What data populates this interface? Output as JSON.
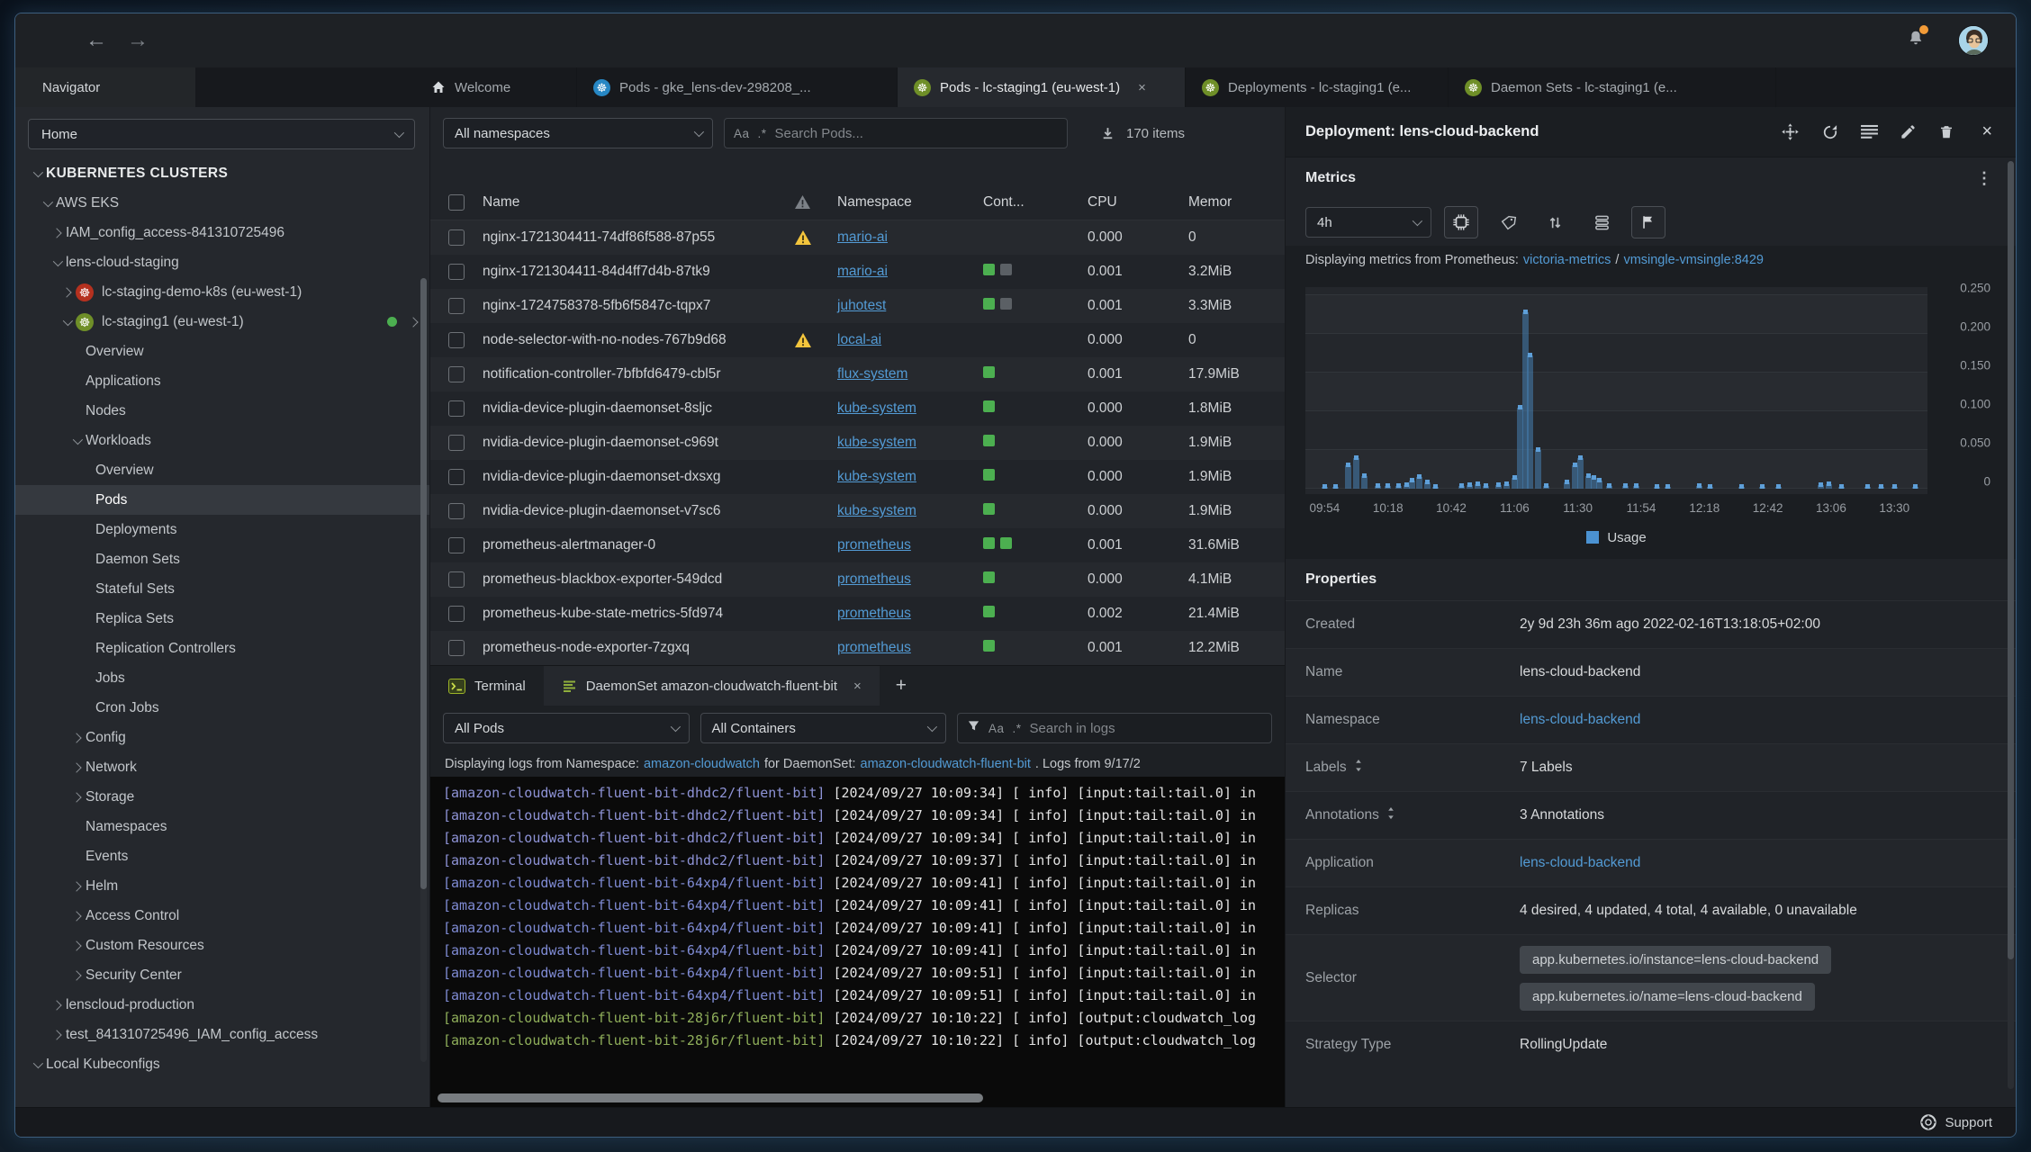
{
  "toolbar": {
    "back": "←",
    "forward": "→",
    "icons": [
      "notifications-bell",
      "user-avatar"
    ]
  },
  "tabs": {
    "navigator_label": "Navigator",
    "items": [
      {
        "label": "Welcome",
        "icon": "home"
      },
      {
        "label": "Pods - gke_lens-dev-298208_...",
        "icon": "k8s-blue"
      },
      {
        "label": "Pods - lc-staging1 (eu-west-1)",
        "icon": "k8s-green",
        "active": true,
        "closable": true
      },
      {
        "label": "Deployments - lc-staging1 (e...",
        "icon": "k8s-green"
      },
      {
        "label": "Daemon Sets - lc-staging1 (e...",
        "icon": "k8s-green"
      }
    ]
  },
  "sidebar": {
    "context_select": "Home",
    "tree": [
      {
        "depth": 0,
        "chevron": "down",
        "label": "KUBERNETES CLUSTERS",
        "section": true
      },
      {
        "depth": 1,
        "chevron": "down",
        "label": "AWS EKS"
      },
      {
        "depth": 2,
        "chevron": "right",
        "label": "IAM_config_access-841310725496"
      },
      {
        "depth": 2,
        "chevron": "down",
        "label": "lens-cloud-staging"
      },
      {
        "depth": 3,
        "chevron": "right",
        "icon": "k8s-red",
        "label": "lc-staging-demo-k8s (eu-west-1)"
      },
      {
        "depth": 3,
        "chevron": "down",
        "icon": "k8s-green",
        "label": "lc-staging1 (eu-west-1)",
        "trailing": true
      },
      {
        "depth": 4,
        "label": "Overview"
      },
      {
        "depth": 4,
        "label": "Applications"
      },
      {
        "depth": 4,
        "label": "Nodes"
      },
      {
        "depth": 4,
        "chevron": "down",
        "label": "Workloads"
      },
      {
        "depth": 5,
        "label": "Overview"
      },
      {
        "depth": 5,
        "label": "Pods",
        "selected": true
      },
      {
        "depth": 5,
        "label": "Deployments"
      },
      {
        "depth": 5,
        "label": "Daemon Sets"
      },
      {
        "depth": 5,
        "label": "Stateful Sets"
      },
      {
        "depth": 5,
        "label": "Replica Sets"
      },
      {
        "depth": 5,
        "label": "Replication Controllers"
      },
      {
        "depth": 5,
        "label": "Jobs"
      },
      {
        "depth": 5,
        "label": "Cron Jobs"
      },
      {
        "depth": 4,
        "chevron": "right",
        "label": "Config"
      },
      {
        "depth": 4,
        "chevron": "right",
        "label": "Network"
      },
      {
        "depth": 4,
        "chevron": "right",
        "label": "Storage"
      },
      {
        "depth": 4,
        "label": "Namespaces"
      },
      {
        "depth": 4,
        "label": "Events"
      },
      {
        "depth": 4,
        "chevron": "right",
        "label": "Helm"
      },
      {
        "depth": 4,
        "chevron": "right",
        "label": "Access Control"
      },
      {
        "depth": 4,
        "chevron": "right",
        "label": "Custom Resources"
      },
      {
        "depth": 4,
        "chevron": "right",
        "label": "Security Center"
      },
      {
        "depth": 2,
        "chevron": "right",
        "label": "lenscloud-production"
      },
      {
        "depth": 2,
        "chevron": "right",
        "label": "test_841310725496_IAM_config_access"
      },
      {
        "depth": 0,
        "chevron": "down",
        "label": "Local Kubeconfigs"
      }
    ]
  },
  "pods_view": {
    "namespace_filter": "All namespaces",
    "search_placeholder": "Search Pods...",
    "case_icon": "Aa",
    "regex_icon": ".*",
    "items_count": "170 items",
    "columns": {
      "name": "Name",
      "namespace": "Namespace",
      "containers": "Cont...",
      "cpu": "CPU",
      "memory": "Memor"
    },
    "rows": [
      {
        "name": "nginx-1721304411-74df86f588-87p55",
        "warning": true,
        "namespace": "mario-ai",
        "containers": [],
        "cpu": "0.000",
        "memory": "0"
      },
      {
        "name": "nginx-1721304411-84d4ff7d4b-87tk9",
        "warning": false,
        "namespace": "mario-ai",
        "containers": [
          "ok",
          "off"
        ],
        "cpu": "0.001",
        "memory": "3.2MiB"
      },
      {
        "name": "nginx-1724758378-5fb6f5847c-tqpx7",
        "warning": false,
        "namespace": "juhotest",
        "containers": [
          "ok",
          "off"
        ],
        "cpu": "0.001",
        "memory": "3.3MiB"
      },
      {
        "name": "node-selector-with-no-nodes-767b9d68",
        "warning": true,
        "namespace": "local-ai",
        "containers": [],
        "cpu": "0.000",
        "memory": "0"
      },
      {
        "name": "notification-controller-7bfbfd6479-cbl5r",
        "warning": false,
        "namespace": "flux-system",
        "containers": [
          "ok"
        ],
        "cpu": "0.001",
        "memory": "17.9MiB"
      },
      {
        "name": "nvidia-device-plugin-daemonset-8sljc",
        "warning": false,
        "namespace": "kube-system",
        "containers": [
          "ok"
        ],
        "cpu": "0.000",
        "memory": "1.8MiB"
      },
      {
        "name": "nvidia-device-plugin-daemonset-c969t",
        "warning": false,
        "namespace": "kube-system",
        "containers": [
          "ok"
        ],
        "cpu": "0.000",
        "memory": "1.9MiB"
      },
      {
        "name": "nvidia-device-plugin-daemonset-dxsxg",
        "warning": false,
        "namespace": "kube-system",
        "containers": [
          "ok"
        ],
        "cpu": "0.000",
        "memory": "1.9MiB"
      },
      {
        "name": "nvidia-device-plugin-daemonset-v7sc6",
        "warning": false,
        "namespace": "kube-system",
        "containers": [
          "ok"
        ],
        "cpu": "0.000",
        "memory": "1.9MiB"
      },
      {
        "name": "prometheus-alertmanager-0",
        "warning": false,
        "namespace": "prometheus",
        "containers": [
          "ok",
          "ok"
        ],
        "cpu": "0.001",
        "memory": "31.6MiB"
      },
      {
        "name": "prometheus-blackbox-exporter-549dcd",
        "warning": false,
        "namespace": "prometheus",
        "containers": [
          "ok"
        ],
        "cpu": "0.000",
        "memory": "4.1MiB"
      },
      {
        "name": "prometheus-kube-state-metrics-5fd974",
        "warning": false,
        "namespace": "prometheus",
        "containers": [
          "ok"
        ],
        "cpu": "0.002",
        "memory": "21.4MiB"
      },
      {
        "name": "prometheus-node-exporter-7zgxq",
        "warning": false,
        "namespace": "prometheus",
        "containers": [
          "ok"
        ],
        "cpu": "0.001",
        "memory": "12.2MiB"
      }
    ]
  },
  "dock": {
    "tabs": [
      {
        "label": "Terminal",
        "icon": "terminal"
      },
      {
        "label": "DaemonSet amazon-cloudwatch-fluent-bit",
        "icon": "logs",
        "active": true,
        "closable": true
      }
    ],
    "new_tab": "+",
    "pod_filter": "All Pods",
    "container_filter": "All Containers",
    "search_placeholder": "Search in logs",
    "log_info": {
      "prefix": "Displaying logs from Namespace:",
      "namespace_link": "amazon-cloudwatch",
      "mid": "for DaemonSet:",
      "daemonset_link": "amazon-cloudwatch-fluent-bit",
      "suffix": ". Logs from 9/17/2"
    },
    "log_lines": [
      {
        "prefix": "[amazon-cloudwatch-fluent-bit-dhdc2/fluent-bit]",
        "color": "purple",
        "body": "[2024/09/27 10:09:34] [ info] [input:tail:tail.0] in"
      },
      {
        "prefix": "[amazon-cloudwatch-fluent-bit-dhdc2/fluent-bit]",
        "color": "purple",
        "body": "[2024/09/27 10:09:34] [ info] [input:tail:tail.0] in"
      },
      {
        "prefix": "[amazon-cloudwatch-fluent-bit-dhdc2/fluent-bit]",
        "color": "purple",
        "body": "[2024/09/27 10:09:34] [ info] [input:tail:tail.0] in"
      },
      {
        "prefix": "[amazon-cloudwatch-fluent-bit-dhdc2/fluent-bit]",
        "color": "purple",
        "body": "[2024/09/27 10:09:37] [ info] [input:tail:tail.0] in"
      },
      {
        "prefix": "[amazon-cloudwatch-fluent-bit-64xp4/fluent-bit]",
        "color": "blue",
        "body": "[2024/09/27 10:09:41] [ info] [input:tail:tail.0] in"
      },
      {
        "prefix": "[amazon-cloudwatch-fluent-bit-64xp4/fluent-bit]",
        "color": "blue",
        "body": "[2024/09/27 10:09:41] [ info] [input:tail:tail.0] in"
      },
      {
        "prefix": "[amazon-cloudwatch-fluent-bit-64xp4/fluent-bit]",
        "color": "blue",
        "body": "[2024/09/27 10:09:41] [ info] [input:tail:tail.0] in"
      },
      {
        "prefix": "[amazon-cloudwatch-fluent-bit-64xp4/fluent-bit]",
        "color": "blue",
        "body": "[2024/09/27 10:09:41] [ info] [input:tail:tail.0] in"
      },
      {
        "prefix": "[amazon-cloudwatch-fluent-bit-64xp4/fluent-bit]",
        "color": "blue",
        "body": "[2024/09/27 10:09:51] [ info] [input:tail:tail.0] in"
      },
      {
        "prefix": "[amazon-cloudwatch-fluent-bit-64xp4/fluent-bit]",
        "color": "blue",
        "body": "[2024/09/27 10:09:51] [ info] [input:tail:tail.0] in"
      },
      {
        "prefix": "[amazon-cloudwatch-fluent-bit-28j6r/fluent-bit]",
        "color": "green",
        "body": "[2024/09/27 10:10:22] [ info] [output:cloudwatch_log"
      },
      {
        "prefix": "[amazon-cloudwatch-fluent-bit-28j6r/fluent-bit]",
        "color": "green",
        "body": "[2024/09/27 10:10:22] [ info] [output:cloudwatch_log"
      }
    ]
  },
  "detail_panel": {
    "title": "Deployment: lens-cloud-backend",
    "header_icons": [
      "move",
      "refresh",
      "list",
      "edit",
      "trash"
    ],
    "metrics": {
      "section_label": "Metrics",
      "range": "4h",
      "toolbar_icons": [
        "cpu-chip",
        "tag",
        "sort-arrows",
        "stack",
        "flag"
      ],
      "source_prefix": "Displaying metrics from Prometheus:",
      "source_link1": "victoria-metrics",
      "source_sep": "/",
      "source_link2": "vmsingle-vmsingle:8429",
      "legend": "Usage"
    },
    "properties": {
      "section_label": "Properties",
      "rows": [
        {
          "label": "Created",
          "value": "2y 9d 23h 36m ago 2022-02-16T13:18:05+02:00"
        },
        {
          "label": "Name",
          "value": "lens-cloud-backend"
        },
        {
          "label": "Namespace",
          "value": "lens-cloud-backend",
          "link": true
        },
        {
          "label": "Labels",
          "sortable": true,
          "value": "7 Labels"
        },
        {
          "label": "Annotations",
          "sortable": true,
          "value": "3 Annotations"
        },
        {
          "label": "Application",
          "value": "lens-cloud-backend",
          "link": true
        },
        {
          "label": "Replicas",
          "value": "4 desired, 4 updated, 4 total, 4 available, 0 unavailable"
        },
        {
          "label": "Selector",
          "badges": [
            "app.kubernetes.io/instance=lens-cloud-backend",
            "app.kubernetes.io/name=lens-cloud-backend"
          ]
        },
        {
          "label": "Strategy Type",
          "value": "RollingUpdate"
        }
      ]
    }
  },
  "chart_data": {
    "type": "bar",
    "title": "Deployment lens-cloud-backend usage",
    "legend_entries": [
      "Usage"
    ],
    "legend_position": "bottom",
    "grid": true,
    "accent_color": "#4b92d2",
    "xticks": [
      "09:54",
      "10:18",
      "10:42",
      "11:06",
      "11:30",
      "11:54",
      "12:18",
      "12:42",
      "13:06",
      "13:30"
    ],
    "yticks": [
      "0.250",
      "0.200",
      "0.150",
      "0.100",
      "0.050",
      "0"
    ],
    "ylim": [
      0,
      0.267
    ],
    "x_minutes_span": 240,
    "points": [
      [
        0,
        0.002
      ],
      [
        4,
        0.002
      ],
      [
        9,
        0.03
      ],
      [
        12,
        0.04
      ],
      [
        15,
        0.016
      ],
      [
        20,
        0.003
      ],
      [
        24,
        0.004
      ],
      [
        28,
        0.004
      ],
      [
        31,
        0.005
      ],
      [
        33,
        0.01
      ],
      [
        36,
        0.015
      ],
      [
        39,
        0.008
      ],
      [
        42,
        0.002
      ],
      [
        52,
        0.003
      ],
      [
        55,
        0.005
      ],
      [
        58,
        0.006
      ],
      [
        61,
        0.004
      ],
      [
        66,
        0.005
      ],
      [
        69,
        0.006
      ],
      [
        72,
        0.014
      ],
      [
        74,
        0.105
      ],
      [
        76,
        0.228
      ],
      [
        78,
        0.172
      ],
      [
        81,
        0.05
      ],
      [
        84,
        0.004
      ],
      [
        92,
        0.008
      ],
      [
        95,
        0.03
      ],
      [
        97,
        0.04
      ],
      [
        100,
        0.016
      ],
      [
        102,
        0.014
      ],
      [
        104,
        0.01
      ],
      [
        108,
        0.003
      ],
      [
        114,
        0.003
      ],
      [
        118,
        0.003
      ],
      [
        126,
        0.002
      ],
      [
        130,
        0.002
      ],
      [
        142,
        0.003
      ],
      [
        146,
        0.002
      ],
      [
        158,
        0.002
      ],
      [
        166,
        0.002
      ],
      [
        172,
        0.002
      ],
      [
        188,
        0.005
      ],
      [
        191,
        0.006
      ],
      [
        196,
        0.002
      ],
      [
        206,
        0.002
      ],
      [
        211,
        0.002
      ],
      [
        216,
        0.002
      ],
      [
        224,
        0.002
      ],
      [
        231,
        0.004
      ],
      [
        234,
        0.003
      ]
    ]
  },
  "status_bar": {
    "support_label": "Support"
  }
}
